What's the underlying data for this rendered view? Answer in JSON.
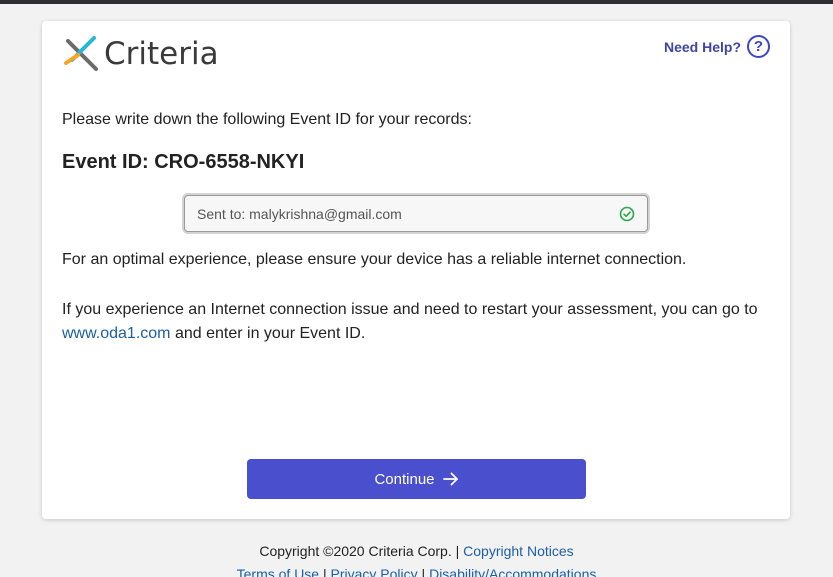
{
  "header": {
    "logo_text": "Criteria",
    "help_label": "Need Help?",
    "help_icon_glyph": "?"
  },
  "main": {
    "instruction": "Please write down the following Event ID for your records:",
    "event_id_label": "Event ID: CRO-6558-NKYI",
    "sent_to": "Sent to: malykrishna@gmail.com",
    "paragraph_1": "For an optimal experience, please ensure your device has a reliable internet connection.",
    "paragraph_2_before": "If you experience an Internet connection issue and need to restart your assessment, you can go to",
    "paragraph_2_link": "www.oda1.com",
    "paragraph_2_after": "and enter in your Event ID.",
    "continue_label": "Continue"
  },
  "footer": {
    "copyright": "Copyright ©2020 Criteria Corp.",
    "sep": "|",
    "copyright_notices": "Copyright Notices",
    "terms": "Terms of Use",
    "privacy": "Privacy Policy",
    "disability": "Disability/Accommodations"
  },
  "colors": {
    "accent": "#4a4fce",
    "link": "#1b5fa8",
    "help": "#3f45c9",
    "success": "#2aa84a",
    "logo_cyan": "#27b6d8",
    "logo_orange": "#f5a623",
    "logo_gray": "#6b6b6b"
  },
  "icons": {
    "logo": "criteria-x-logo-icon",
    "help": "question-circle-icon",
    "check": "check-circle-icon",
    "continue": "arrow-right-icon"
  }
}
